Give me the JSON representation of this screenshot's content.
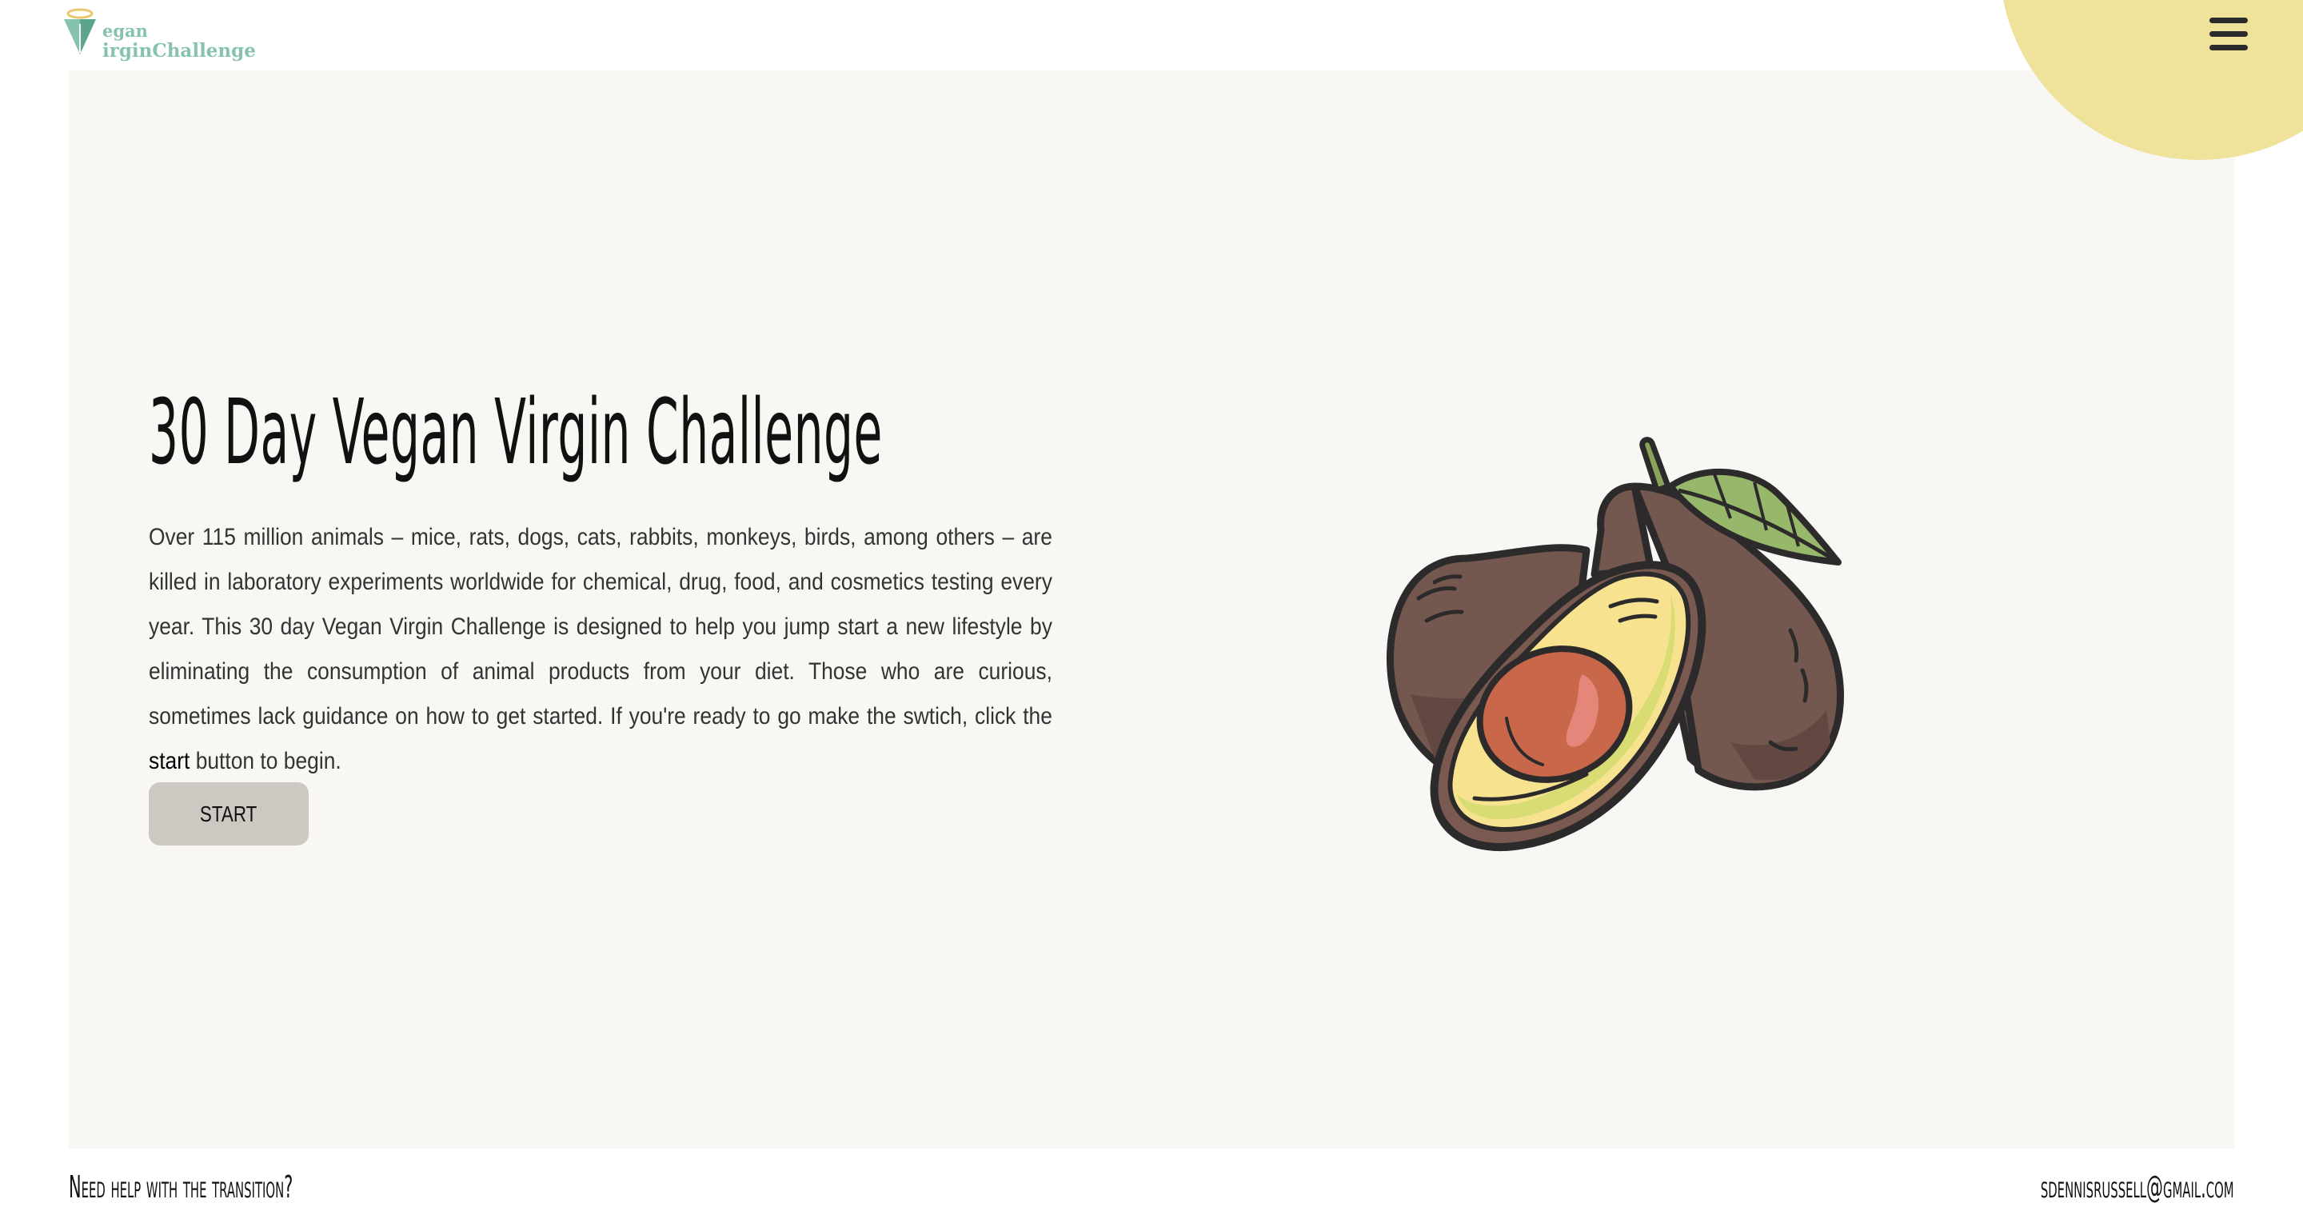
{
  "header": {
    "logo_line1": "egan",
    "logo_line2": "irginChallenge",
    "menu_icon": "hamburger-menu-icon"
  },
  "hero": {
    "title": "30 Day Vegan Virgin Challenge",
    "text_before": "Over 115 million animals – mice, rats, dogs, cats, rabbits, monkeys, birds, among others – are killed in laboratory experiments worldwide for chemical, drug, food, and cosmetics testing every year. This 30 day Vegan Virgin Challenge is designed to help you jump start a new lifestyle by eliminating the consumption of animal products from your diet. Those who are curious, sometimes lack guidance on how to get started. If you're ready to go make the swtich, click the ",
    "text_emphasis": "start",
    "text_after": " button to begin.",
    "start_label": "START",
    "illustration": "avocado-illustration"
  },
  "footer": {
    "left_text": "Need help with the transition?",
    "right_text": "sdennisrussell@gmail.com"
  },
  "colors": {
    "accent_circle": "#efe39c",
    "hero_background": "#f8f7f3",
    "button_background": "#cdc8c2",
    "logo_green": "#86c3ad"
  }
}
